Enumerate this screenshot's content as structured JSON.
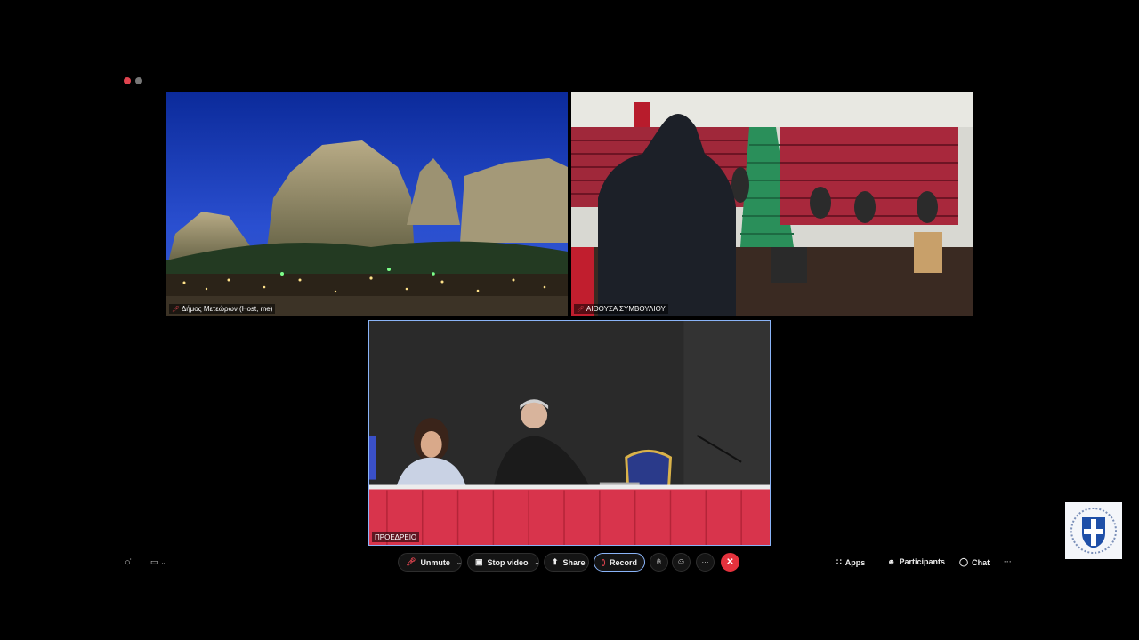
{
  "window": {
    "controls": [
      {
        "name": "close",
        "color": "#e0444f"
      },
      {
        "name": "minimize",
        "color": "#777777"
      }
    ]
  },
  "tiles": [
    {
      "id": "host",
      "label": "Δήμος Μετεώρων (Host, me)",
      "muted": true
    },
    {
      "id": "hall",
      "label": "ΑΙΘΟΥΣΑ ΣΥΜΒΟΥΛΙΟΥ",
      "muted": true
    },
    {
      "id": "presidium",
      "label": "ΠΡΟΕΔΡΕΙΟ",
      "muted": false,
      "active_speaker": true
    }
  ],
  "toolbar": {
    "unmute_label": "Unmute",
    "stop_video_label": "Stop video",
    "share_label": "Share",
    "record_label": "Record",
    "more_label": "···",
    "apps_label": "Apps",
    "participants_label": "Participants",
    "chat_label": "Chat",
    "overflow_label": "···"
  },
  "icons": {
    "mic": "mic-muted-icon",
    "video": "video-camera-icon",
    "share": "share-screen-icon",
    "record": "record-icon",
    "raise_hand": "raise-hand-icon",
    "reactions": "reactions-icon",
    "leave": "leave-x-icon",
    "apps": "apps-icon",
    "participants": "participants-icon",
    "chat": "chat-bubble-icon",
    "layout": "layout-icon",
    "captions": "captions-icon"
  },
  "colors": {
    "background": "#000000",
    "active_border": "#8ab4f8",
    "leave_red": "#e5323d",
    "record_red": "#e0444f",
    "accent": "#4c8cf5"
  }
}
